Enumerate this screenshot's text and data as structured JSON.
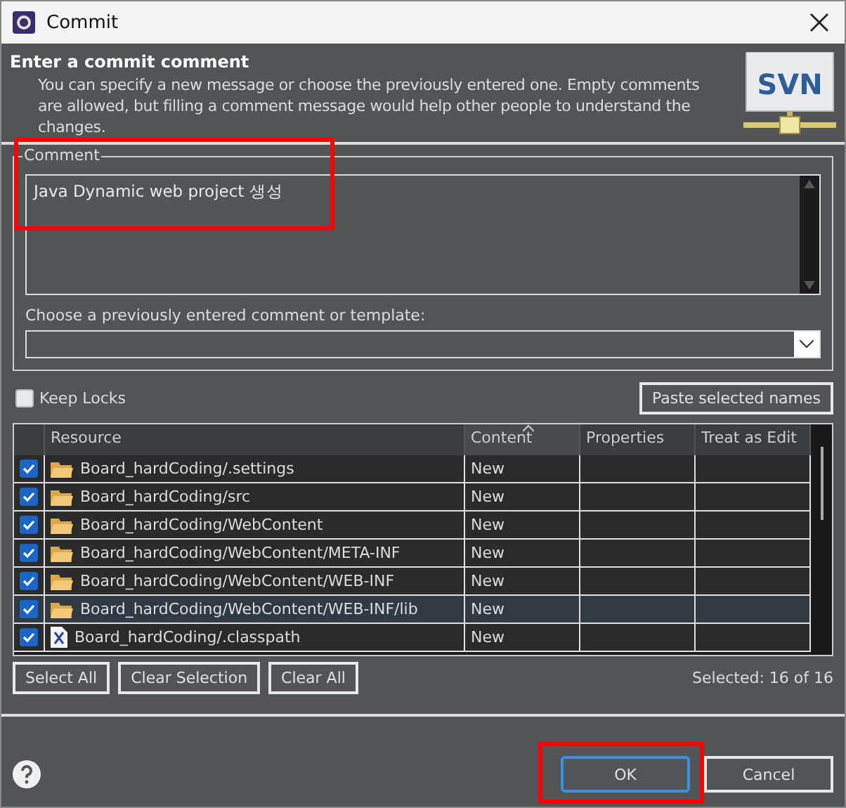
{
  "window": {
    "title": "Commit"
  },
  "header": {
    "title": "Enter a commit comment",
    "description": "You can specify a new message or choose the previously entered one. Empty comments are allowed, but filling a comment message would help other people to understand the changes.",
    "logo": "SVN"
  },
  "comment": {
    "label": "Comment",
    "value": "Java Dynamic web project 생성",
    "highlighted": true
  },
  "template": {
    "label": "Choose a previously entered comment or template:"
  },
  "keep_locks": {
    "label": "Keep Locks",
    "checked": false
  },
  "paste_button": "Paste selected names",
  "table": {
    "columns": [
      {
        "label": "Resource",
        "sorted": false
      },
      {
        "label": "Content",
        "sorted": true
      },
      {
        "label": "Properties",
        "sorted": false
      },
      {
        "label": "Treat as Edit",
        "sorted": false
      }
    ],
    "rows": [
      {
        "kind": "folder",
        "resource": "Board_hardCoding/.settings",
        "content": "New",
        "checked": true,
        "selected": false
      },
      {
        "kind": "folder",
        "resource": "Board_hardCoding/src",
        "content": "New",
        "checked": true,
        "selected": false
      },
      {
        "kind": "folder",
        "resource": "Board_hardCoding/WebContent",
        "content": "New",
        "checked": true,
        "selected": false
      },
      {
        "kind": "folder",
        "resource": "Board_hardCoding/WebContent/META-INF",
        "content": "New",
        "checked": true,
        "selected": false
      },
      {
        "kind": "folder",
        "resource": "Board_hardCoding/WebContent/WEB-INF",
        "content": "New",
        "checked": true,
        "selected": false
      },
      {
        "kind": "folder",
        "resource": "Board_hardCoding/WebContent/WEB-INF/lib",
        "content": "New",
        "checked": true,
        "selected": true
      },
      {
        "kind": "file",
        "resource": "Board_hardCoding/.classpath",
        "content": "New",
        "checked": true,
        "selected": false
      }
    ]
  },
  "selection_buttons": [
    "Select All",
    "Clear Selection",
    "Clear All"
  ],
  "selected_count": "Selected: 16 of 16",
  "dialog_buttons": [
    {
      "label": "OK",
      "default": true,
      "highlighted": true
    },
    {
      "label": "Cancel",
      "default": false,
      "highlighted": false
    }
  ]
}
